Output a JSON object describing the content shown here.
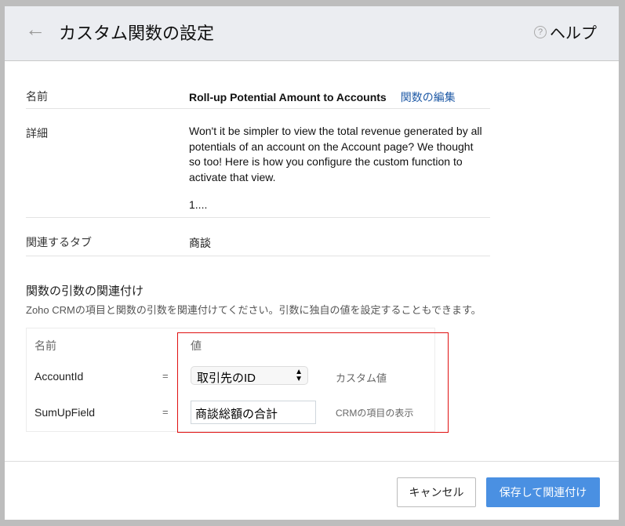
{
  "header": {
    "title": "カスタム関数の設定",
    "help_label": "ヘルプ",
    "help_icon": "?"
  },
  "details": {
    "name_label": "名前",
    "name_value": "Roll-up Potential Amount to Accounts",
    "edit_link": "関数の編集",
    "desc_label": "詳細",
    "desc_value": "Won't it be simpler to view the total revenue generated by all potentials of an account on the Account page? We thought so too! Here is how you configure the custom function to activate that view.",
    "desc_more": "1....",
    "tab_label": "関連するタブ",
    "tab_value": "商談"
  },
  "mapping": {
    "title": "関数の引数の関連付け",
    "subtitle": "Zoho CRMの項目と関数の引数を関連付けてください。引数に独自の値を設定することもできます。",
    "col_name": "名前",
    "col_value": "値",
    "rows": [
      {
        "name": "AccountId",
        "eq": "=",
        "value": "取引先のID",
        "type": "カスタム値"
      },
      {
        "name": "SumUpField",
        "eq": "=",
        "value": "商談総額の合計",
        "type": "CRMの項目の表示"
      }
    ]
  },
  "footer": {
    "cancel": "キャンセル",
    "save": "保存して関連付け"
  }
}
